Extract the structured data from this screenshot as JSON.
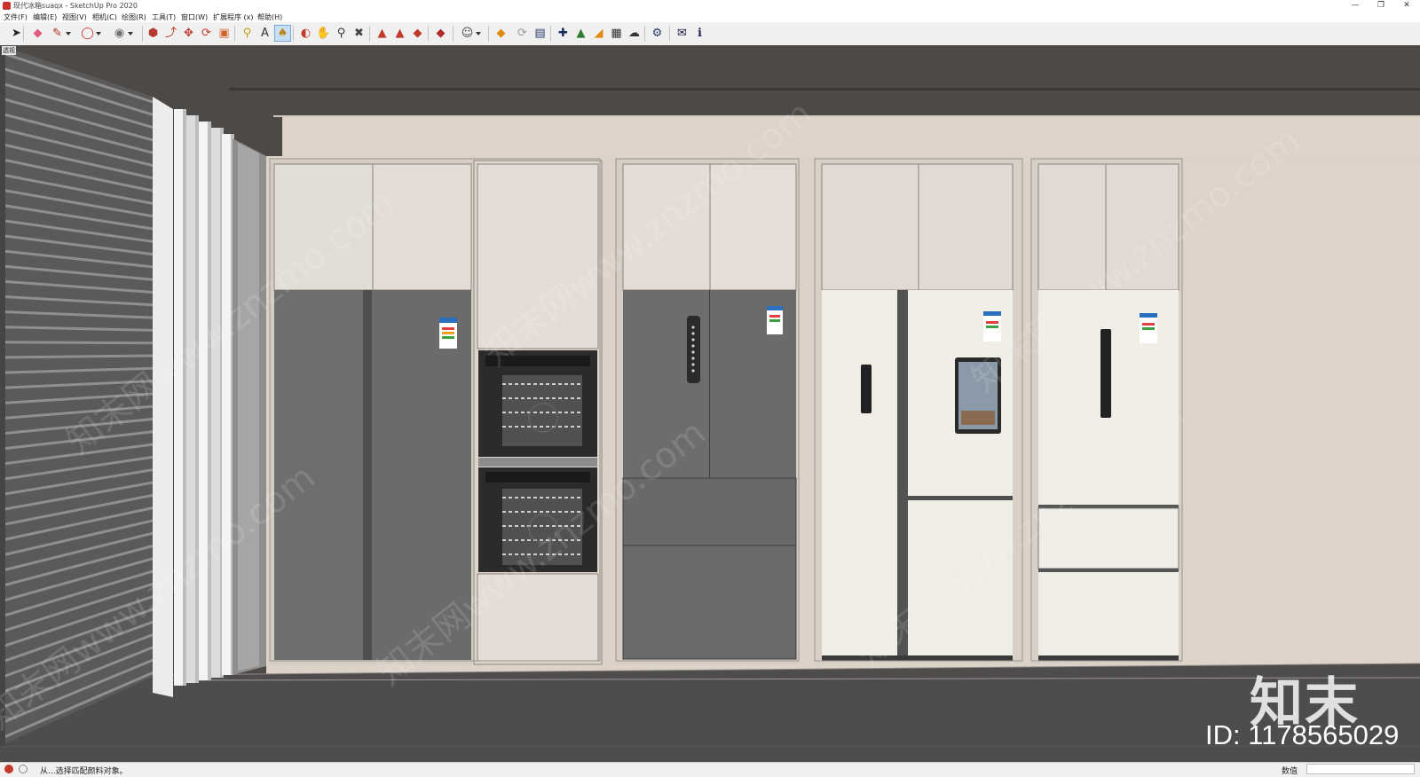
{
  "window": {
    "title": "现代冰箱suaqx - SketchUp Pro 2020",
    "controls": [
      "—",
      "❐",
      "✕"
    ]
  },
  "menu": [
    "文件(F)",
    "编辑(E)",
    "视图(V)",
    "相机(C)",
    "绘图(R)",
    "工具(T)",
    "窗口(W)",
    "扩展程序 (x)",
    "帮助(H)"
  ],
  "toolbar": {
    "icons": [
      {
        "name": "select-icon",
        "glyph": "➤",
        "color": "#222222"
      },
      {
        "name": "eraser-icon",
        "glyph": "◆",
        "color": "#e05a7a"
      },
      {
        "name": "line-icon",
        "glyph": "✎",
        "color": "#b0302a"
      },
      {
        "name": "shapes-icon",
        "glyph": "◯",
        "color": "#d03030"
      },
      {
        "name": "circle-icon",
        "glyph": "◉",
        "color": "#6e6e6e"
      },
      {
        "name": "push-pull-icon",
        "glyph": "⬢",
        "color": "#b23a2e"
      },
      {
        "name": "follow-me-icon",
        "glyph": "⤴",
        "color": "#c0392b"
      },
      {
        "name": "move-icon",
        "glyph": "✥",
        "color": "#c0392b"
      },
      {
        "name": "rotate-icon",
        "glyph": "⟳",
        "color": "#c0392b"
      },
      {
        "name": "scale-icon",
        "glyph": "▣",
        "color": "#d2642a"
      },
      {
        "name": "tape-measure-icon",
        "glyph": "⚲",
        "color": "#c59b10"
      },
      {
        "name": "text-icon",
        "glyph": "A",
        "color": "#333333"
      },
      {
        "name": "paint-bucket-icon",
        "glyph": "♠",
        "color": "#c08a20"
      },
      {
        "name": "orbit-icon",
        "glyph": "◐",
        "color": "#c0392b"
      },
      {
        "name": "pan-icon",
        "glyph": "✋",
        "color": "#c8a060"
      },
      {
        "name": "zoom-icon",
        "glyph": "⚲",
        "color": "#333333"
      },
      {
        "name": "zoom-extents-icon",
        "glyph": "✖",
        "color": "#444444"
      },
      {
        "name": "warehouse-icon",
        "glyph": "▲",
        "color": "#c0392b"
      },
      {
        "name": "extension-icon",
        "glyph": "▲",
        "color": "#c0392b"
      },
      {
        "name": "share-icon",
        "glyph": "◆",
        "color": "#c0392b"
      },
      {
        "name": "ruby-icon",
        "glyph": "◆",
        "color": "#b0282a"
      },
      {
        "name": "profile-icon",
        "glyph": "☺",
        "color": "#444444"
      },
      {
        "name": "export-icon",
        "glyph": "◆",
        "color": "#e08a10"
      },
      {
        "name": "sync-icon",
        "glyph": "⟳",
        "color": "#9a9a9a"
      },
      {
        "name": "layers-icon",
        "glyph": "▤",
        "color": "#2a3a6a"
      },
      {
        "name": "add-icon",
        "glyph": "✚",
        "color": "#1a2a5a"
      },
      {
        "name": "tree-icon",
        "glyph": "▲",
        "color": "#2e7d32"
      },
      {
        "name": "material-icon",
        "glyph": "◢",
        "color": "#e08a10"
      },
      {
        "name": "pattern-icon",
        "glyph": "▦",
        "color": "#333333"
      },
      {
        "name": "cloud-icon",
        "glyph": "☁",
        "color": "#333333"
      },
      {
        "name": "settings-icon",
        "glyph": "⚙",
        "color": "#2a3a6a"
      },
      {
        "name": "mail-icon",
        "glyph": "✉",
        "color": "#1a1a3a"
      },
      {
        "name": "info-icon",
        "glyph": "ℹ",
        "color": "#1a2a5a"
      }
    ]
  },
  "viewport": {
    "label": "透视",
    "watermark_text": "知末网www.znzmo.com",
    "watermark_logo": "知末",
    "watermark_id": "ID: 1178565029"
  },
  "status": {
    "message": "从...选择匹配颜料对象。",
    "measure_label": "数值",
    "measure_value": ""
  }
}
